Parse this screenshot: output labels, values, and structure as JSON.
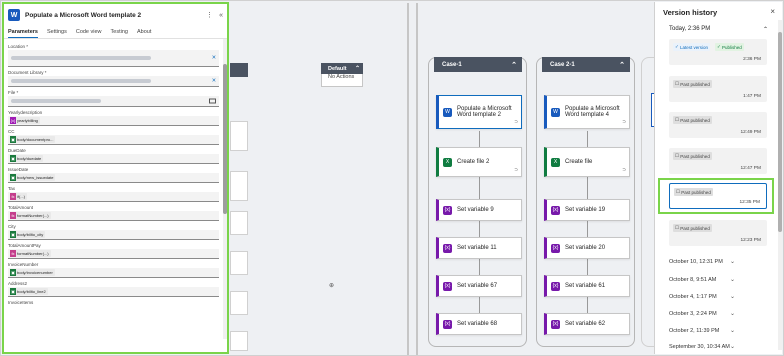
{
  "panel": {
    "title": "Populate a Microsoft Word template 2",
    "tabs": [
      "Parameters",
      "Settings",
      "Code view",
      "Testing",
      "About"
    ],
    "fields": [
      {
        "label": "Location *"
      },
      {
        "label": "Document Library *"
      },
      {
        "label": "File *"
      },
      {
        "label": "Yearlydescription",
        "token": "yearlybilling",
        "kind": "purple"
      },
      {
        "label": "CC",
        "token": "body/documentpro...",
        "kind": "green"
      },
      {
        "label": "DueDate",
        "token": "body/duedate",
        "kind": "green"
      },
      {
        "label": "IssueDate",
        "token": "body/new_issuedate",
        "kind": "green"
      },
      {
        "label": "Tax",
        "token": "if(...)",
        "kind": "pink"
      },
      {
        "label": "TotalAmount",
        "token": "formatNumber(...)",
        "kind": "pink"
      },
      {
        "label": "City",
        "token": "body/billto_city",
        "kind": "green"
      },
      {
        "label": "TotalAmountPay",
        "token": "formatNumber(...)",
        "kind": "pink"
      },
      {
        "label": "InvoiceNumber",
        "token": "body/invoicenumber",
        "kind": "green"
      },
      {
        "label": "Address2",
        "token": "body/billto_line2",
        "kind": "green"
      },
      {
        "label": "InvoiceItems"
      }
    ]
  },
  "canvas": {
    "default_case": {
      "title": "Default",
      "body": "No Actions"
    },
    "cases": [
      {
        "title": "Case-1",
        "nodes": [
          {
            "label": "Populate a Microsoft Word template 2",
            "kind": "word"
          },
          {
            "label": "Create file 2",
            "kind": "excel"
          },
          {
            "label": "Set variable 9",
            "kind": "var"
          },
          {
            "label": "Set variable 11",
            "kind": "var"
          },
          {
            "label": "Set variable 67",
            "kind": "var"
          },
          {
            "label": "Set variable 68",
            "kind": "var"
          }
        ]
      },
      {
        "title": "Case 2-1",
        "nodes": [
          {
            "label": "Populate a Microsoft Word template 4",
            "kind": "word"
          },
          {
            "label": "Create file",
            "kind": "excel"
          },
          {
            "label": "Set variable 19",
            "kind": "var"
          },
          {
            "label": "Set variable 20",
            "kind": "var"
          },
          {
            "label": "Set variable 61",
            "kind": "var"
          },
          {
            "label": "Set variable 62",
            "kind": "var"
          }
        ]
      }
    ]
  },
  "version_history": {
    "title": "Version history",
    "today": "Today, 2:36 PM",
    "latest_label": "Latest version",
    "published_label": "Published",
    "past_label": "Past published",
    "versions": [
      {
        "time": "2:36 PM",
        "latest": true
      },
      {
        "time": "1:47 PM"
      },
      {
        "time": "12:49 PM"
      },
      {
        "time": "12:47 PM"
      },
      {
        "time": "12:35 PM",
        "selected": true
      },
      {
        "time": "12:23 PM"
      }
    ],
    "dates": [
      "October 10, 12:31 PM",
      "October 8, 9:51 AM",
      "October 4, 1:17 PM",
      "October 3, 2:24 PM",
      "October 2, 11:39 PM",
      "September 30, 10:34 AM"
    ]
  },
  "colors": {
    "highlight": "#7ad44a",
    "accent": "#0f6cbd",
    "word": "#185abd",
    "excel": "#107c41",
    "variable": "#7719aa"
  }
}
